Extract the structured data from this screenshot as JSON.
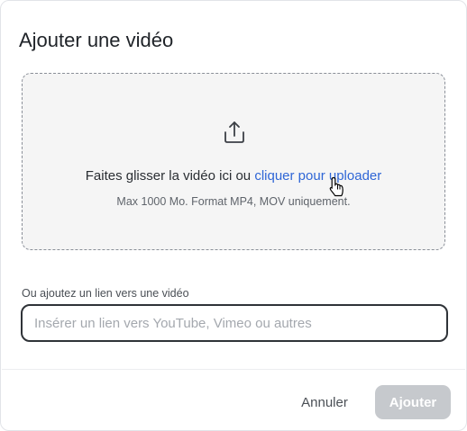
{
  "modal": {
    "title": "Ajouter une vidéo"
  },
  "dropzone": {
    "icon": "upload-icon",
    "instruction_prefix": "Faites glisser la vidéo ici ou",
    "link_text": "cliquer pour uploader",
    "hint": "Max 1000 Mo. Format MP4, MOV uniquement."
  },
  "link_section": {
    "label": "Ou ajoutez un lien vers une vidéo",
    "input_value": "",
    "placeholder": "Insérer un lien vers YouTube, Vimeo ou autres"
  },
  "footer": {
    "cancel_label": "Annuler",
    "submit_label": "Ajouter",
    "submit_disabled": true
  },
  "cursor": {
    "icon": "hand-pointer-icon"
  },
  "colors": {
    "accent_link": "#2f66d6",
    "disabled_button": "#c6c9cd",
    "dropzone_bg": "#f5f5f5"
  }
}
